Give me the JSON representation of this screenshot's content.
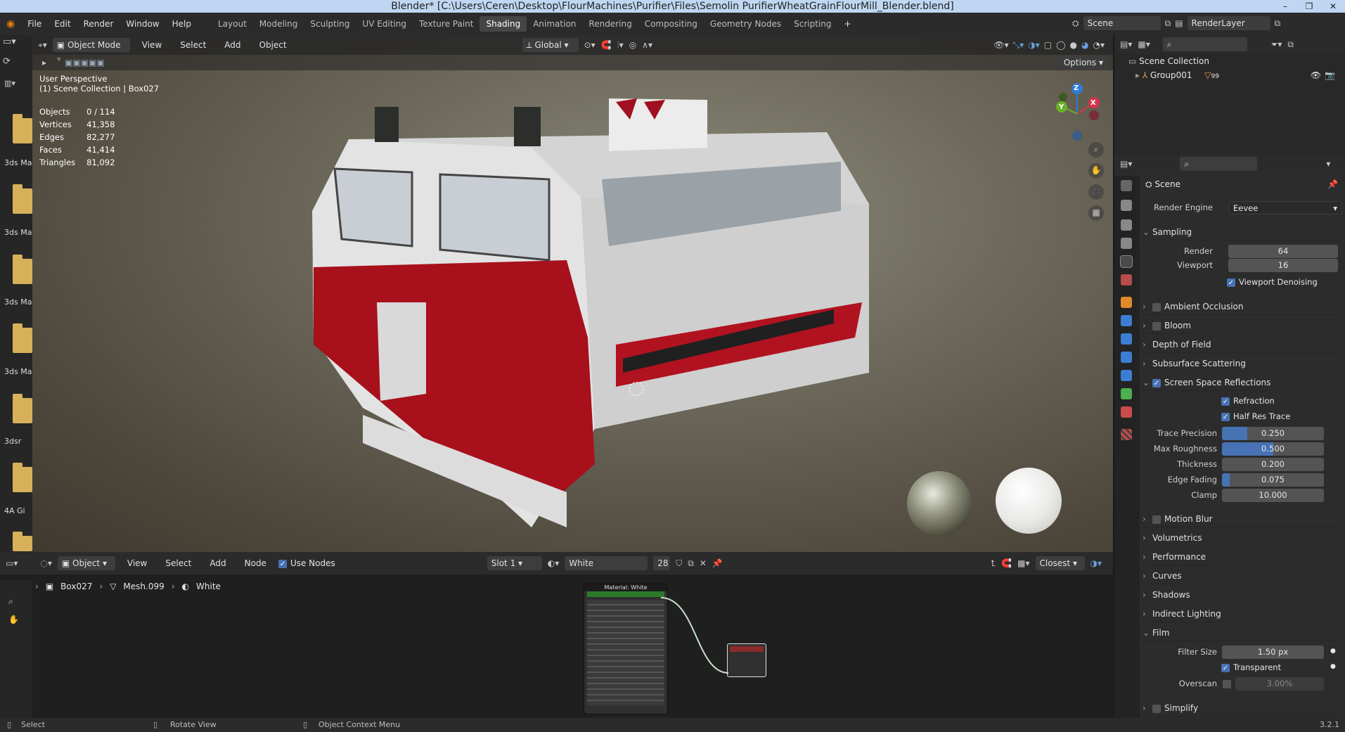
{
  "window": {
    "title": "Blender* [C:\\Users\\Ceren\\Desktop\\FlourMachines\\Purifier\\Files\\Semolin PurifierWheatGrainFlourMill_Blender.blend]"
  },
  "menu": {
    "items": [
      "File",
      "Edit",
      "Render",
      "Window",
      "Help"
    ]
  },
  "workspaces": [
    "Layout",
    "Modeling",
    "Sculpting",
    "UV Editing",
    "Texture Paint",
    "Shading",
    "Animation",
    "Rendering",
    "Compositing",
    "Geometry Nodes",
    "Scripting"
  ],
  "active_workspace": "Shading",
  "scene": {
    "name": "Scene",
    "view_layer": "RenderLayer"
  },
  "viewport": {
    "mode": "Object Mode",
    "menus": [
      "View",
      "Select",
      "Add",
      "Object"
    ],
    "transform": "Global",
    "options_label": "Options",
    "perspective": "User Perspective",
    "collection_path": "(1) Scene Collection | Box027",
    "stats": {
      "labels": [
        "Objects",
        "Vertices",
        "Edges",
        "Faces",
        "Triangles"
      ],
      "values": [
        "0 / 114",
        "41,358",
        "82,277",
        "41,414",
        "81,092"
      ]
    },
    "gizmo_axes": [
      "Z",
      "Y",
      "X"
    ]
  },
  "file_browser": {
    "items": [
      "3ds Ma:",
      "3ds Ma:",
      "3ds Ma:",
      "3ds Ma:",
      "3dsr",
      "4A Gi"
    ]
  },
  "node_editor": {
    "object_mode": "Object",
    "menus": [
      "View",
      "Select",
      "Add",
      "Node"
    ],
    "use_nodes_label": "Use Nodes",
    "use_nodes": true,
    "slot": "Slot 1",
    "material": "White",
    "users": "28",
    "interpolation": "Closest",
    "breadcrumb": [
      "Box027",
      "Mesh.099",
      "White"
    ],
    "material_node_title": "Material: White"
  },
  "outliner": {
    "root": "Scene Collection",
    "items": [
      {
        "label": "Group001",
        "badge": "99"
      }
    ]
  },
  "properties": {
    "context": "Scene",
    "render_engine_label": "Render Engine",
    "render_engine": "Eevee",
    "sections": {
      "sampling": "Sampling",
      "ambient_occlusion": "Ambient Occlusion",
      "bloom": "Bloom",
      "depth_of_field": "Depth of Field",
      "subsurface": "Subsurface Scattering",
      "ssr": "Screen Space Reflections",
      "motion_blur": "Motion Blur",
      "volumetrics": "Volumetrics",
      "performance": "Performance",
      "curves": "Curves",
      "shadows": "Shadows",
      "indirect": "Indirect Lighting",
      "film": "Film",
      "simplify": "Simplify"
    },
    "sampling": {
      "render_label": "Render",
      "render": "64",
      "viewport_label": "Viewport",
      "viewport": "16",
      "denoise_label": "Viewport Denoising"
    },
    "ssr": {
      "refraction_label": "Refraction",
      "half_res_label": "Half Res Trace",
      "trace_precision_label": "Trace Precision",
      "trace_precision": "0.250",
      "trace_precision_frac": 0.25,
      "max_roughness_label": "Max Roughness",
      "max_roughness": "0.500",
      "max_roughness_frac": 0.5,
      "thickness_label": "Thickness",
      "thickness": "0.200",
      "thickness_frac": 0.0,
      "edge_fading_label": "Edge Fading",
      "edge_fading": "0.075",
      "edge_fading_frac": 0.075,
      "clamp_label": "Clamp",
      "clamp": "10.000",
      "clamp_frac": 0.0
    },
    "film": {
      "filter_size_label": "Filter Size",
      "filter_size": "1.50 px",
      "transparent_label": "Transparent",
      "overscan_label": "Overscan",
      "overscan": "3.00%"
    }
  },
  "statusbar": {
    "select": "Select",
    "rotate": "Rotate View",
    "context_menu": "Object Context Menu",
    "version": "3.2.1"
  }
}
